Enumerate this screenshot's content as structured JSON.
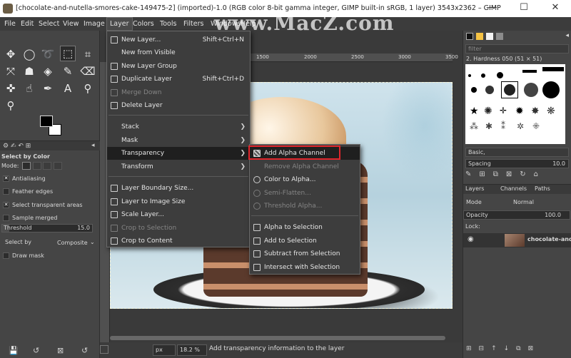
{
  "window": {
    "title": "[chocolate-and-nutella-smores-cake-149475-2] (imported)-1.0 (RGB color 8-bit gamma integer, GIMP built-in sRGB, 1 layer) 3543x2362 – GIMP",
    "minimize": "—",
    "maximize": "☐",
    "close": "✕"
  },
  "watermark": "www.MacZ.com",
  "menubar": [
    "File",
    "Edit",
    "Select",
    "View",
    "Image",
    "Layer",
    "Colors",
    "Tools",
    "Filters",
    "Windows",
    "Help"
  ],
  "toolbox": {
    "tool_options_title": "Select by Color",
    "mode_label": "Mode:",
    "antialiasing": "Antialiasing",
    "feather_edges": "Feather edges",
    "select_transparent": "Select transparent areas",
    "sample_merged": "Sample merged",
    "threshold_label": "Threshold",
    "threshold_value": "15.0",
    "select_by_label": "Select by",
    "select_by_value": "Composite",
    "draw_mask": "Draw mask"
  },
  "ruler": {
    "marks": [
      "1500",
      "2000",
      "2500",
      "3000",
      "3500"
    ]
  },
  "layer_menu": {
    "items": [
      {
        "label": "New Layer...",
        "shortcut": "Shift+Ctrl+N"
      },
      {
        "label": "New from Visible"
      },
      {
        "label": "New Layer Group"
      },
      {
        "label": "Duplicate Layer",
        "shortcut": "Shift+Ctrl+D"
      },
      {
        "label": "Merge Down"
      },
      {
        "label": "Delete Layer"
      },
      {
        "label": "Stack"
      },
      {
        "label": "Mask"
      },
      {
        "label": "Transparency"
      },
      {
        "label": "Transform"
      },
      {
        "label": "Layer Boundary Size..."
      },
      {
        "label": "Layer to Image Size"
      },
      {
        "label": "Scale Layer..."
      },
      {
        "label": "Crop to Selection"
      },
      {
        "label": "Crop to Content"
      }
    ]
  },
  "transparency_menu": {
    "items": [
      {
        "label": "Add Alpha Channel"
      },
      {
        "label": "Remove Alpha Channel"
      },
      {
        "label": "Color to Alpha..."
      },
      {
        "label": "Semi-Flatten..."
      },
      {
        "label": "Threshold Alpha..."
      },
      {
        "label": "Alpha to Selection"
      },
      {
        "label": "Add to Selection"
      },
      {
        "label": "Subtract from Selection"
      },
      {
        "label": "Intersect with Selection"
      }
    ]
  },
  "statusbar": {
    "unit": "px",
    "zoom": "18.2 %",
    "message": "Add transparency information to the layer"
  },
  "brushes": {
    "filter_placeholder": "filter",
    "current": "2. Hardness 050 (51 × 51)",
    "tag_value": "Basic,",
    "spacing_label": "Spacing",
    "spacing_value": "10.0"
  },
  "layers": {
    "tabs": [
      "Layers",
      "Channels",
      "Paths"
    ],
    "mode_label": "Mode",
    "mode_value": "Normal",
    "opacity_label": "Opacity",
    "opacity_value": "100.0",
    "lock_label": "Lock:",
    "layer_name": "chocolate-and"
  },
  "colors": {
    "highlight_box": "#e0262c",
    "menu_bg": "#3d3d3d",
    "menu_hover": "#1f1f1f"
  }
}
